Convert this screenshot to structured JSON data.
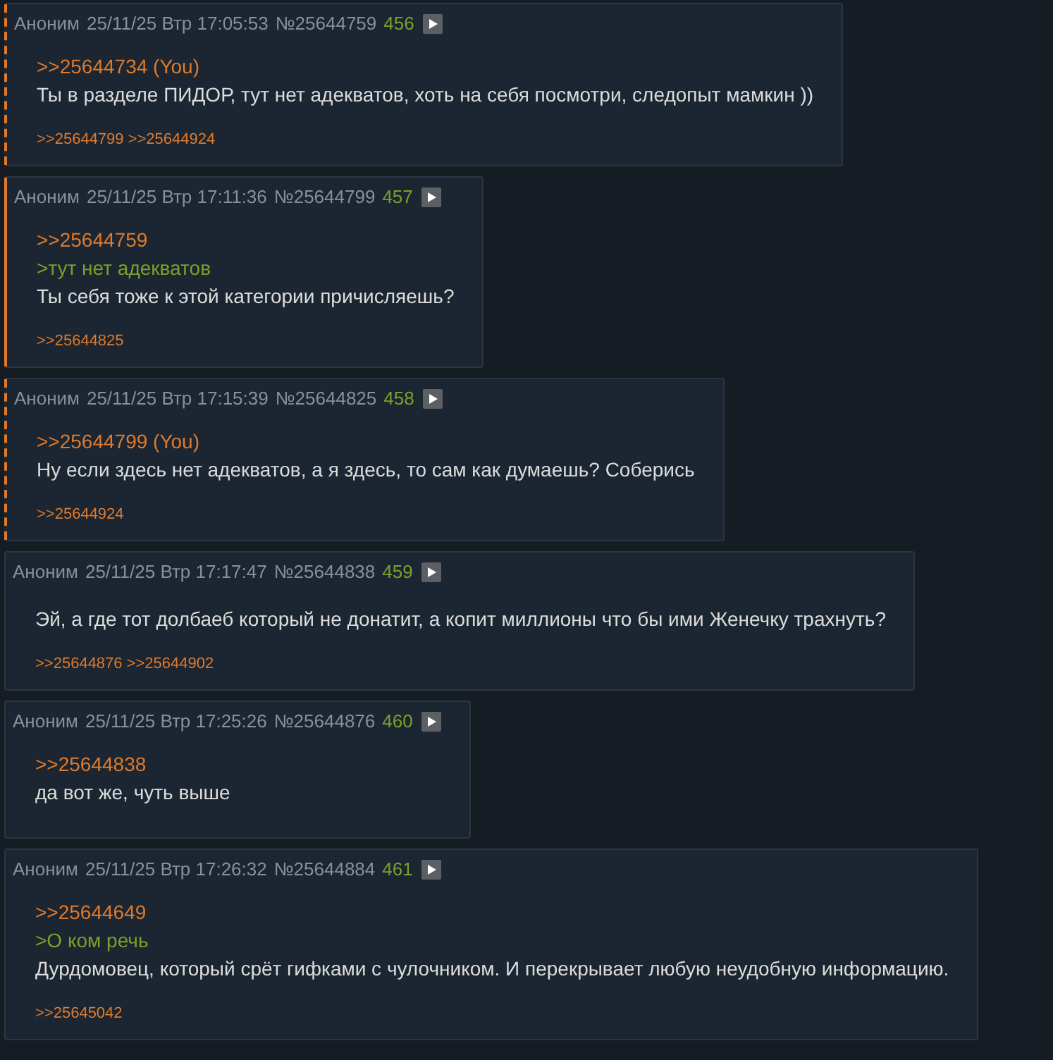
{
  "posts": [
    {
      "name": "Аноним",
      "date": "25/11/25 Втр 17:05:53",
      "number": "№25644759",
      "ordinal": "456",
      "own": false,
      "reply_to_you": true,
      "lines": [
        {
          "kind": "link",
          "text": ">>25644734 (You)"
        },
        {
          "kind": "text",
          "text": "Ты в разделе ПИДОР, тут нет адекватов, хоть на себя посмотри, следопыт мамкин ))"
        }
      ],
      "replies": [
        ">>25644799",
        ">>25644924"
      ]
    },
    {
      "name": "Аноним",
      "date": "25/11/25 Втр 17:11:36",
      "number": "№25644799",
      "ordinal": "457",
      "own": true,
      "reply_to_you": false,
      "lines": [
        {
          "kind": "link",
          "text": ">>25644759"
        },
        {
          "kind": "quote",
          "text": ">тут нет адекватов"
        },
        {
          "kind": "text",
          "text": "Ты себя тоже к этой категории причисляешь?"
        }
      ],
      "replies": [
        ">>25644825"
      ]
    },
    {
      "name": "Аноним",
      "date": "25/11/25 Втр 17:15:39",
      "number": "№25644825",
      "ordinal": "458",
      "own": false,
      "reply_to_you": true,
      "lines": [
        {
          "kind": "link",
          "text": ">>25644799 (You)"
        },
        {
          "kind": "text",
          "text": "Ну если здесь нет адекватов, а я здесь, то сам как думаешь? Соберись"
        }
      ],
      "replies": [
        ">>25644924"
      ]
    },
    {
      "name": "Аноним",
      "date": "25/11/25 Втр 17:17:47",
      "number": "№25644838",
      "ordinal": "459",
      "own": false,
      "reply_to_you": false,
      "lines": [
        {
          "kind": "text",
          "text": "Эй, а где тот долбаеб который не донатит, а копит миллионы что бы ими Женечку трахнуть?"
        }
      ],
      "replies": [
        ">>25644876",
        ">>25644902"
      ]
    },
    {
      "name": "Аноним",
      "date": "25/11/25 Втр 17:25:26",
      "number": "№25644876",
      "ordinal": "460",
      "own": false,
      "reply_to_you": false,
      "lines": [
        {
          "kind": "link",
          "text": ">>25644838"
        },
        {
          "kind": "text",
          "text": "да вот же, чуть выше"
        }
      ]
    },
    {
      "name": "Аноним",
      "date": "25/11/25 Втр 17:26:32",
      "number": "№25644884",
      "ordinal": "461",
      "own": false,
      "reply_to_you": false,
      "lines": [
        {
          "kind": "link",
          "text": ">>25644649"
        },
        {
          "kind": "quote",
          "text": ">О ком речь"
        },
        {
          "kind": "text",
          "text": "Дурдомовец, который срёт гифками с чулочником. И перекрывает любую неудобную информацию."
        }
      ],
      "replies": [
        ">>25645042"
      ]
    }
  ]
}
